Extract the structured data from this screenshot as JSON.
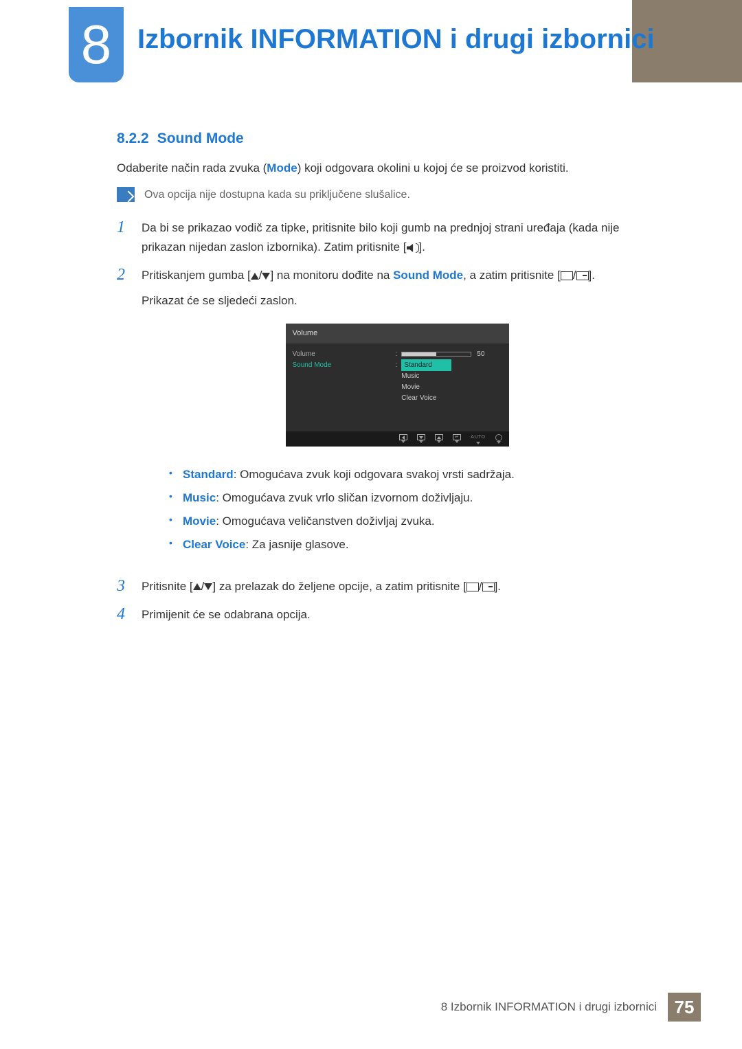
{
  "chapter": {
    "number": "8",
    "title": "Izbornik INFORMATION i drugi izbornici"
  },
  "section": {
    "number": "8.2.2",
    "title": "Sound Mode"
  },
  "intro": {
    "pre": "Odaberite način rada zvuka (",
    "mode": "Mode",
    "post": ") koji odgovara okolini u kojoj će se proizvod koristiti."
  },
  "note": "Ova opcija nije dostupna kada su priključene slušalice.",
  "steps": {
    "s1": "Da bi se prikazao vodič za tipke, pritisnite bilo koji gumb na prednjoj strani uređaja (kada nije prikazan nijedan zaslon izbornika). Zatim pritisnite [",
    "s1_end": "].",
    "s2_a": "Pritiskanjem gumba [",
    "s2_b": "] na monitoru dođite na ",
    "s2_target": "Sound Mode",
    "s2_c": ", a zatim pritisnite [",
    "s2_d": "].",
    "s2_after": "Prikazat će se sljedeći zaslon.",
    "s3_a": "Pritisnite [",
    "s3_b": "] za prelazak do željene opcije, a zatim pritisnite [",
    "s3_c": "].",
    "s4": "Primijenit će se odabrana opcija."
  },
  "osd": {
    "title": "Volume",
    "row_volume": "Volume",
    "row_soundmode": "Sound Mode",
    "volume_value": "50",
    "options": {
      "standard": "Standard",
      "music": "Music",
      "movie": "Movie",
      "clearvoice": "Clear Voice"
    },
    "auto": "AUTO"
  },
  "bullets": {
    "standard_label": "Standard",
    "standard_text": ": Omogućava zvuk koji odgovara svakoj vrsti sadržaja.",
    "music_label": "Music",
    "music_text": ": Omogućava zvuk vrlo sličan izvornom doživljaju.",
    "movie_label": "Movie",
    "movie_text": ": Omogućava veličanstven doživljaj zvuka.",
    "clearvoice_label": "Clear Voice",
    "clearvoice_text": ": Za jasnije glasove."
  },
  "footer": {
    "text": "8 Izbornik INFORMATION i drugi izbornici",
    "page": "75"
  }
}
